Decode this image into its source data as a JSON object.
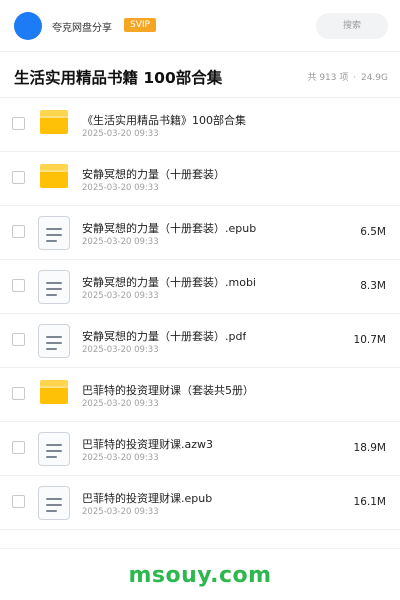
{
  "header": {
    "share_name": "夸克网盘分享",
    "badge": "SVIP",
    "search_placeholder": "搜索"
  },
  "folder": {
    "title": "生活实用精品书籍 100部合集",
    "count_text": "共 913 项",
    "separator": "·",
    "total_size": "24.9G"
  },
  "files": [
    {
      "type": "folder",
      "name": "《生活实用精品书籍》100部合集",
      "date": "2025-03-20 09:33",
      "size": ""
    },
    {
      "type": "folder",
      "name": "安静冥想的力量（十册套装）",
      "date": "2025-03-20 09:33",
      "size": ""
    },
    {
      "type": "file",
      "name": "安静冥想的力量（十册套装）.epub",
      "date": "2025-03-20 09:33",
      "size": "6.5M"
    },
    {
      "type": "file",
      "name": "安静冥想的力量（十册套装）.mobi",
      "date": "2025-03-20 09:33",
      "size": "8.3M"
    },
    {
      "type": "file",
      "name": "安静冥想的力量（十册套装）.pdf",
      "date": "2025-03-20 09:33",
      "size": "10.7M"
    },
    {
      "type": "folder",
      "name": "巴菲特的投资理财课（套装共5册）",
      "date": "2025-03-20 09:33",
      "size": ""
    },
    {
      "type": "file",
      "name": "巴菲特的投资理财课.azw3",
      "date": "2025-03-20 09:33",
      "size": "18.9M"
    },
    {
      "type": "file",
      "name": "巴菲特的投资理财课.epub",
      "date": "2025-03-20 09:33",
      "size": "16.1M"
    }
  ],
  "footer": {
    "brand": "msouy.com",
    "brand_color": "#2db84d"
  },
  "colors": {
    "avatar": "#1e7bf6",
    "svip_badge": "#f5a623",
    "folder": "#ffc107"
  }
}
